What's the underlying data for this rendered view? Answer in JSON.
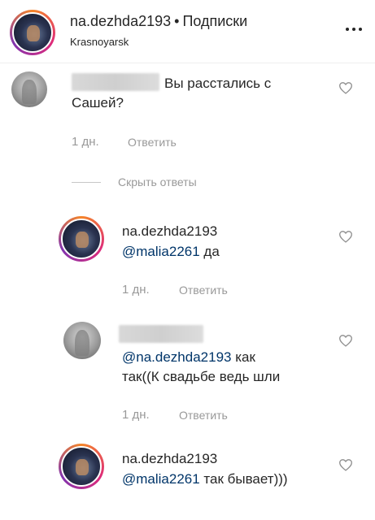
{
  "header": {
    "username": "na.dezhda2193",
    "separator": "•",
    "follow_status": "Подписки",
    "location": "Krasnoyarsk"
  },
  "comments": [
    {
      "text_line1": "Вы расстались с",
      "text_line2": "Сашей?",
      "time": "1 дн.",
      "reply": "Ответить"
    }
  ],
  "hide_replies": "Скрыть ответы",
  "replies": [
    {
      "username": "na.dezhda2193",
      "mention": "@malia2261",
      "text": " да",
      "time": "1 дн.",
      "reply": "Ответить"
    },
    {
      "mention": "@na.dezhda2193",
      "text": " как",
      "text_line2": "так((К свадьбе ведь шли",
      "time": "1 дн.",
      "reply": "Ответить"
    },
    {
      "username": "na.dezhda2193",
      "mention": "@malia2261",
      "text": " так бывает)))"
    }
  ]
}
